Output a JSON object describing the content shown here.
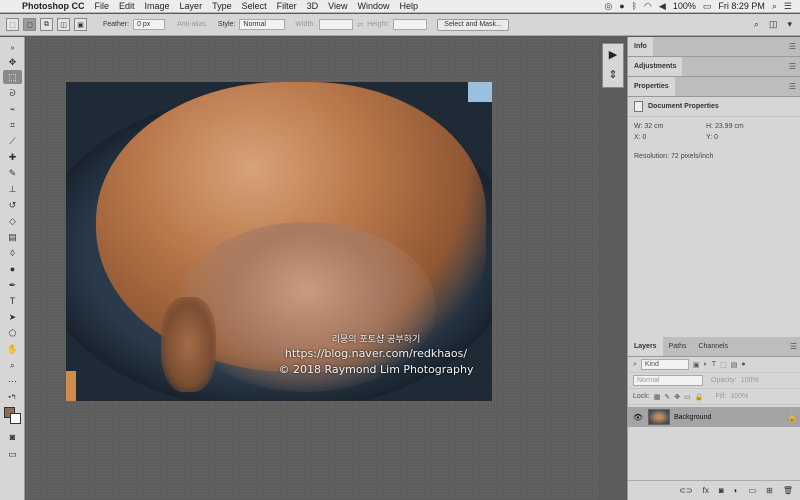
{
  "menubar": {
    "app": "Photoshop CC",
    "items": [
      "File",
      "Edit",
      "Image",
      "Layer",
      "Type",
      "Select",
      "Filter",
      "3D",
      "View",
      "Window",
      "Help"
    ],
    "battery": "100%",
    "clock": "Fri 8:29 PM"
  },
  "options": {
    "feather_label": "Feather:",
    "feather_value": "0 px",
    "antialias": "Anti-alias",
    "style_label": "Style:",
    "style_value": "Normal",
    "width_label": "Width:",
    "height_label": "Height:",
    "select_mask": "Select and Mask..."
  },
  "canvas": {
    "watermark_line1": "리뭉의 포토샵 공부하기",
    "watermark_line2": "https://blog.naver.com/redkhaos/",
    "watermark_line3": "© 2018 Raymond Lim Photography"
  },
  "panels": {
    "info_tab": "Info",
    "adjustments_tab": "Adjustments",
    "properties_tab": "Properties",
    "doc_props_title": "Document Properties",
    "w": "W:  32 cm",
    "h": "H:  23.99 cm",
    "x": "X:  0",
    "y": "Y:  0",
    "resolution": "Resolution: 72 pixels/inch"
  },
  "layers": {
    "tabs": [
      "Layers",
      "Paths",
      "Channels"
    ],
    "kind": "Kind",
    "blend": "Normal",
    "opacity_label": "Opacity:",
    "opacity_value": "100%",
    "lock_label": "Lock:",
    "fill_label": "Fill:",
    "fill_value": "100%",
    "layer_name": "Background"
  },
  "colors": {
    "foreground": "#8b6f55",
    "background": "#ffffff",
    "panel_bg": "#d6d6d6",
    "workspace_bg": "#5e5e5e"
  }
}
